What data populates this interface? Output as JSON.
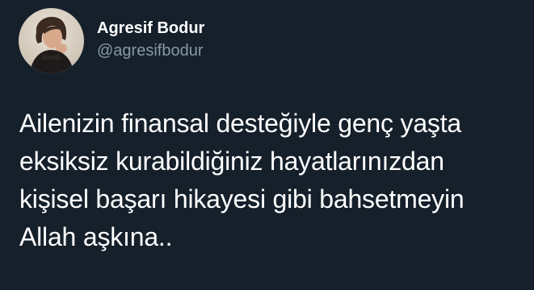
{
  "author": {
    "display_name": "Agresif Bodur",
    "handle": "@agresifbodur",
    "avatar": "profile-photo"
  },
  "tweet": {
    "lines": [
      "Ailenizin finansal desteğiyle genç yaşta",
      "eksiksiz kurabildiğiniz hayatlarınızdan",
      "kişisel başarı hikayesi gibi bahsetmeyin",
      "Allah aşkına.."
    ]
  },
  "colors": {
    "background": "#15202b",
    "primary_text": "#ffffff",
    "secondary_text": "#8899a6"
  }
}
